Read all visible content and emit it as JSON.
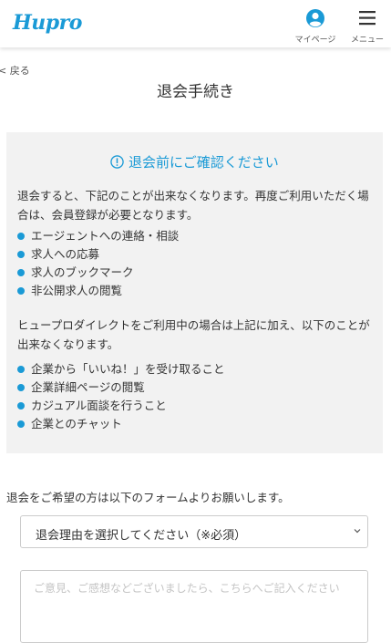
{
  "header": {
    "logo_text": "Hupro",
    "mypage_label": "マイページ",
    "menu_label": "メニュー",
    "accent_color": "#1a9ad6"
  },
  "nav": {
    "back_label": "戻る"
  },
  "page": {
    "title": "退会手続き"
  },
  "notice": {
    "heading": "退会前にご確認ください",
    "intro": "退会すると、下記のことが出来なくなります。再度ご利用いただく場合は、会員登録が必要となります。",
    "items": [
      "エージェントへの連絡・相談",
      "求人への応募",
      "求人のブックマーク",
      "非公開求人の閲覧"
    ],
    "direct_intro": "ヒュープロダイレクトをご利用中の場合は上記に加え、以下のことが出来なくなります。",
    "direct_items": [
      "企業から「いいね！」を受け取ること",
      "企業詳細ページの閲覧",
      "カジュアル面談を行うこと",
      "企業とのチャット"
    ]
  },
  "form": {
    "intro": "退会をご希望の方は以下のフォームよりお願いします。",
    "reason_select": "退会理由を選択してください（※必須）",
    "comment_placeholder": "ご意見、ご感想などございましたら、こちらへご記入ください"
  }
}
